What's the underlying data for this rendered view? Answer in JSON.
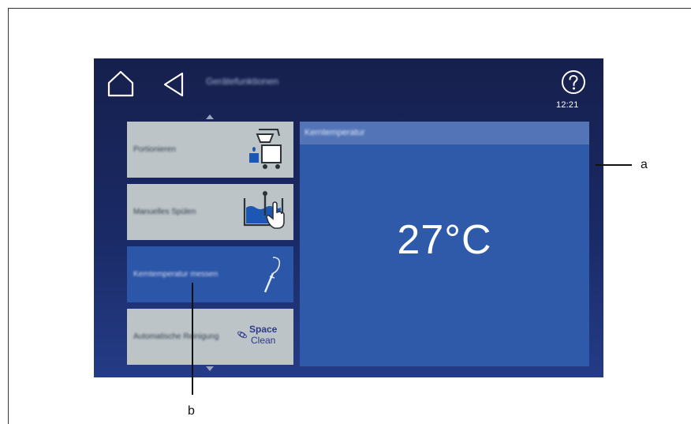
{
  "header": {
    "title": "Gerätefunktionen",
    "time": "12:21",
    "home_icon": "home-icon",
    "back_icon": "back-icon",
    "help_icon": "help-icon"
  },
  "menu": {
    "items": [
      {
        "label": "Portionieren",
        "icon": "portioning-icon",
        "selected": false
      },
      {
        "label": "Manuelles Spülen",
        "icon": "manual-rinse-icon",
        "selected": false
      },
      {
        "label": "Kerntemperatur messen",
        "icon": "core-probe-icon",
        "selected": true
      },
      {
        "label": "Automatische Reinigung",
        "icon": "space-clean-logo",
        "selected": false
      }
    ],
    "logo_text_line1": "Space",
    "logo_text_line2": "Clean"
  },
  "detail": {
    "header": "Kerntemperatur",
    "value": "27°C"
  },
  "callouts": {
    "a": "a",
    "b": "b"
  },
  "colors": {
    "screen_bg": "#1a2a66",
    "selected_item": "#2c56a8",
    "item_bg": "#bcc4c8",
    "detail_panel": "#2f5aa9",
    "detail_header": "#5375b8"
  }
}
